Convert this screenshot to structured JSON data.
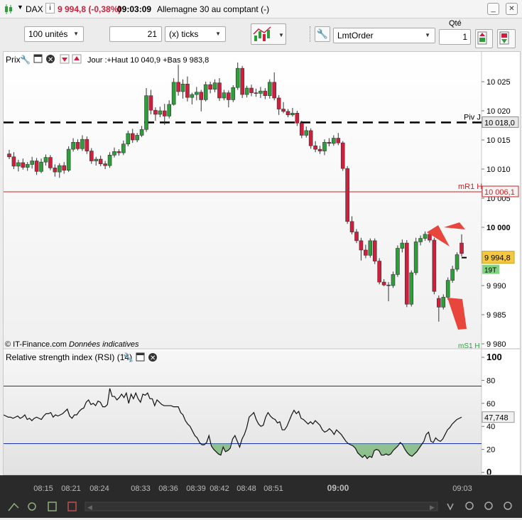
{
  "titlebar": {
    "instrument": "DAX",
    "price_change": "9 994,8 (-0,38%)",
    "time": "09:03:09",
    "description": "Allemagne 30 au comptant (-)"
  },
  "toolbar": {
    "quantity_select": "100 unités",
    "ticks_value": "21",
    "ticks_unit": "(x) ticks",
    "order_type": "LmtOrder",
    "qty_label": "Qté",
    "qty_value": "1"
  },
  "chart": {
    "price_panel_title": "Prix",
    "price_info": "Jour :+Haut 10 040,9 +Bas 9 983,8",
    "copyright": "© IT-Finance.com",
    "indicative": "Données indicatives",
    "rsi_title": "Relative strength index (RSI) (14)",
    "piv_label": "Piv J",
    "mr1_label": "mR1 H",
    "ms1_label": "mS1 H",
    "piv_value": "10 018,0",
    "mr1_value": "10 006,1",
    "last_price": "9 994,8",
    "timer": "19T",
    "rsi_value": "47,748",
    "price_ticks": [
      "10 025",
      "10 020",
      "10 015",
      "10 010",
      "10 005",
      "10 000",
      "9 990",
      "9 985",
      "9 980"
    ],
    "rsi_ticks": [
      "100",
      "80",
      "60",
      "40",
      "20",
      "0"
    ],
    "time_ticks": [
      "08:15",
      "08:21",
      "08:24",
      "08:33",
      "08:36",
      "08:39",
      "08:42",
      "08:48",
      "08:51",
      "09:00",
      "09:03"
    ]
  },
  "colors": {
    "up": "#2e9e3a",
    "down": "#d01f3c",
    "pivot": "#000000",
    "mr1": "#d02020",
    "rsi_band": "#1a2fb0",
    "arrow": "#e8453c",
    "last_price_bg": "#f5c842",
    "timer_bg": "#7ed67e"
  },
  "chart_data": {
    "type": "candlestick",
    "ylim": [
      9980,
      10028
    ],
    "rsi_ylim": [
      0,
      100
    ],
    "rsi_levels": [
      75,
      25
    ],
    "reference_lines": [
      {
        "label": "Piv J",
        "value": 10018.0
      },
      {
        "label": "mR1 H",
        "value": 10006.1
      }
    ],
    "candles": [
      {
        "o": 10012.6,
        "h": 10013.3,
        "l": 10011.7,
        "c": 10012.1
      },
      {
        "o": 10012.1,
        "h": 10012.9,
        "l": 10010.0,
        "c": 10010.5
      },
      {
        "o": 10010.5,
        "h": 10011.6,
        "l": 10009.6,
        "c": 10011.1
      },
      {
        "o": 10011.1,
        "h": 10011.8,
        "l": 10009.9,
        "c": 10010.3
      },
      {
        "o": 10010.3,
        "h": 10011.2,
        "l": 10009.7,
        "c": 10010.8
      },
      {
        "o": 10010.8,
        "h": 10012.1,
        "l": 10010.1,
        "c": 10011.4
      },
      {
        "o": 10011.4,
        "h": 10011.9,
        "l": 10009.0,
        "c": 10009.6
      },
      {
        "o": 10009.6,
        "h": 10011.8,
        "l": 10009.3,
        "c": 10011.2
      },
      {
        "o": 10011.2,
        "h": 10012.5,
        "l": 10010.6,
        "c": 10012.0
      },
      {
        "o": 10012.0,
        "h": 10012.4,
        "l": 10009.8,
        "c": 10010.2
      },
      {
        "o": 10010.2,
        "h": 10010.8,
        "l": 10008.7,
        "c": 10009.5
      },
      {
        "o": 10009.5,
        "h": 10011.0,
        "l": 10008.5,
        "c": 10010.6
      },
      {
        "o": 10010.6,
        "h": 10011.2,
        "l": 10009.2,
        "c": 10009.8
      },
      {
        "o": 10009.8,
        "h": 10013.9,
        "l": 10009.5,
        "c": 10013.4
      },
      {
        "o": 10013.4,
        "h": 10015.3,
        "l": 10013.0,
        "c": 10014.6
      },
      {
        "o": 10014.6,
        "h": 10015.1,
        "l": 10013.2,
        "c": 10013.5
      },
      {
        "o": 10013.5,
        "h": 10015.8,
        "l": 10013.1,
        "c": 10015.1
      },
      {
        "o": 10015.1,
        "h": 10015.6,
        "l": 10012.6,
        "c": 10013.1
      },
      {
        "o": 10013.1,
        "h": 10013.6,
        "l": 10010.9,
        "c": 10011.4
      },
      {
        "o": 10011.4,
        "h": 10012.1,
        "l": 10010.6,
        "c": 10011.7
      },
      {
        "o": 10011.7,
        "h": 10012.3,
        "l": 10010.5,
        "c": 10010.9
      },
      {
        "o": 10010.9,
        "h": 10011.4,
        "l": 10010.0,
        "c": 10010.6
      },
      {
        "o": 10010.6,
        "h": 10012.9,
        "l": 10010.2,
        "c": 10012.4
      },
      {
        "o": 10012.4,
        "h": 10013.7,
        "l": 10012.0,
        "c": 10013.0
      },
      {
        "o": 10013.0,
        "h": 10013.4,
        "l": 10012.3,
        "c": 10012.8
      },
      {
        "o": 10012.8,
        "h": 10014.9,
        "l": 10012.4,
        "c": 10014.3
      },
      {
        "o": 10014.3,
        "h": 10016.6,
        "l": 10013.9,
        "c": 10016.1
      },
      {
        "o": 10016.1,
        "h": 10016.9,
        "l": 10014.5,
        "c": 10015.0
      },
      {
        "o": 10015.0,
        "h": 10016.2,
        "l": 10014.6,
        "c": 10015.8
      },
      {
        "o": 10015.8,
        "h": 10017.4,
        "l": 10015.5,
        "c": 10016.8
      },
      {
        "o": 10016.8,
        "h": 10023.9,
        "l": 10016.4,
        "c": 10022.6
      },
      {
        "o": 10022.6,
        "h": 10023.6,
        "l": 10019.4,
        "c": 10020.1
      },
      {
        "o": 10020.1,
        "h": 10020.6,
        "l": 10018.3,
        "c": 10019.4
      },
      {
        "o": 10019.4,
        "h": 10020.7,
        "l": 10018.9,
        "c": 10020.0
      },
      {
        "o": 10020.0,
        "h": 10021.2,
        "l": 10017.6,
        "c": 10019.1
      },
      {
        "o": 10019.1,
        "h": 10021.8,
        "l": 10018.7,
        "c": 10021.1
      },
      {
        "o": 10021.1,
        "h": 10025.6,
        "l": 10020.9,
        "c": 10024.9
      },
      {
        "o": 10024.9,
        "h": 10027.9,
        "l": 10022.6,
        "c": 10023.3
      },
      {
        "o": 10023.3,
        "h": 10025.4,
        "l": 10022.1,
        "c": 10024.6
      },
      {
        "o": 10024.6,
        "h": 10025.9,
        "l": 10021.6,
        "c": 10022.3
      },
      {
        "o": 10022.3,
        "h": 10023.1,
        "l": 10021.1,
        "c": 10022.8
      },
      {
        "o": 10022.8,
        "h": 10024.1,
        "l": 10021.8,
        "c": 10023.2
      },
      {
        "o": 10023.2,
        "h": 10023.6,
        "l": 10019.9,
        "c": 10021.9
      },
      {
        "o": 10021.9,
        "h": 10025.0,
        "l": 10021.6,
        "c": 10024.5
      },
      {
        "o": 10024.5,
        "h": 10025.0,
        "l": 10023.0,
        "c": 10023.7
      },
      {
        "o": 10023.7,
        "h": 10025.4,
        "l": 10023.2,
        "c": 10024.8
      },
      {
        "o": 10024.8,
        "h": 10025.6,
        "l": 10021.7,
        "c": 10022.2
      },
      {
        "o": 10022.2,
        "h": 10023.6,
        "l": 10021.8,
        "c": 10023.1
      },
      {
        "o": 10023.1,
        "h": 10023.5,
        "l": 10020.6,
        "c": 10021.9
      },
      {
        "o": 10021.9,
        "h": 10024.4,
        "l": 10021.5,
        "c": 10024.0
      },
      {
        "o": 10024.0,
        "h": 10028.3,
        "l": 10023.6,
        "c": 10027.3
      },
      {
        "o": 10027.3,
        "h": 10027.7,
        "l": 10022.2,
        "c": 10022.8
      },
      {
        "o": 10022.8,
        "h": 10024.3,
        "l": 10022.3,
        "c": 10023.9
      },
      {
        "o": 10023.9,
        "h": 10024.5,
        "l": 10022.5,
        "c": 10023.1
      },
      {
        "o": 10023.1,
        "h": 10023.8,
        "l": 10022.4,
        "c": 10023.0
      },
      {
        "o": 10023.0,
        "h": 10024.1,
        "l": 10022.2,
        "c": 10023.4
      },
      {
        "o": 10023.4,
        "h": 10023.9,
        "l": 10022.0,
        "c": 10022.6
      },
      {
        "o": 10022.6,
        "h": 10025.4,
        "l": 10022.1,
        "c": 10024.9
      },
      {
        "o": 10024.9,
        "h": 10026.6,
        "l": 10021.8,
        "c": 10022.2
      },
      {
        "o": 10022.2,
        "h": 10022.7,
        "l": 10019.3,
        "c": 10020.3
      },
      {
        "o": 10020.3,
        "h": 10021.5,
        "l": 10019.6,
        "c": 10019.9
      },
      {
        "o": 10019.9,
        "h": 10020.3,
        "l": 10018.9,
        "c": 10019.3
      },
      {
        "o": 10019.3,
        "h": 10020.5,
        "l": 10019.0,
        "c": 10019.6
      },
      {
        "o": 10019.6,
        "h": 10020.0,
        "l": 10017.4,
        "c": 10017.9
      },
      {
        "o": 10017.9,
        "h": 10018.3,
        "l": 10015.3,
        "c": 10015.8
      },
      {
        "o": 10015.8,
        "h": 10017.3,
        "l": 10015.4,
        "c": 10016.6
      },
      {
        "o": 10016.6,
        "h": 10017.0,
        "l": 10013.5,
        "c": 10014.0
      },
      {
        "o": 10014.0,
        "h": 10014.8,
        "l": 10012.9,
        "c": 10013.4
      },
      {
        "o": 10013.4,
        "h": 10014.0,
        "l": 10012.6,
        "c": 10013.1
      },
      {
        "o": 10013.1,
        "h": 10015.1,
        "l": 10012.4,
        "c": 10014.6
      },
      {
        "o": 10014.6,
        "h": 10015.3,
        "l": 10013.9,
        "c": 10014.4
      },
      {
        "o": 10014.4,
        "h": 10015.8,
        "l": 10014.0,
        "c": 10015.3
      },
      {
        "o": 10015.3,
        "h": 10016.2,
        "l": 10014.1,
        "c": 10014.5
      },
      {
        "o": 10014.5,
        "h": 10014.8,
        "l": 10009.7,
        "c": 10010.1
      },
      {
        "o": 10010.1,
        "h": 10010.5,
        "l": 10000.6,
        "c": 10001.0
      },
      {
        "o": 10001.0,
        "h": 10001.9,
        "l": 9998.8,
        "c": 9999.2
      },
      {
        "o": 9999.2,
        "h": 9999.7,
        "l": 9997.3,
        "c": 9997.7
      },
      {
        "o": 9997.7,
        "h": 9998.2,
        "l": 9994.3,
        "c": 9996.1
      },
      {
        "o": 9996.1,
        "h": 9997.0,
        "l": 9994.7,
        "c": 9995.2
      },
      {
        "o": 9995.2,
        "h": 9998.1,
        "l": 9994.8,
        "c": 9997.7
      },
      {
        "o": 9997.7,
        "h": 9998.1,
        "l": 9993.7,
        "c": 9994.2
      },
      {
        "o": 9994.2,
        "h": 9994.7,
        "l": 9990.2,
        "c": 9990.6
      },
      {
        "o": 9990.6,
        "h": 9991.1,
        "l": 9989.9,
        "c": 9990.1
      },
      {
        "o": 9990.1,
        "h": 9990.6,
        "l": 9987.3,
        "c": 9990.0
      },
      {
        "o": 9990.0,
        "h": 9992.4,
        "l": 9989.6,
        "c": 9991.9
      },
      {
        "o": 9991.9,
        "h": 9996.9,
        "l": 9991.5,
        "c": 9996.4
      },
      {
        "o": 9996.4,
        "h": 9997.9,
        "l": 9995.7,
        "c": 9997.3
      },
      {
        "o": 9997.3,
        "h": 9997.8,
        "l": 9986.3,
        "c": 9986.8
      },
      {
        "o": 9986.8,
        "h": 9992.6,
        "l": 9986.4,
        "c": 9992.2
      },
      {
        "o": 9992.2,
        "h": 9998.2,
        "l": 9991.8,
        "c": 9997.5
      },
      {
        "o": 9997.5,
        "h": 9998.6,
        "l": 9996.9,
        "c": 9998.1
      },
      {
        "o": 9998.1,
        "h": 9999.3,
        "l": 9997.7,
        "c": 9998.8
      },
      {
        "o": 9998.8,
        "h": 9999.2,
        "l": 9997.4,
        "c": 9997.8
      },
      {
        "o": 9997.8,
        "h": 9998.2,
        "l": 9988.5,
        "c": 9989.0
      },
      {
        "o": 9987.8,
        "h": 9988.3,
        "l": 9983.8,
        "c": 9986.3
      },
      {
        "o": 9986.3,
        "h": 9988.5,
        "l": 9985.9,
        "c": 9988.0
      },
      {
        "o": 9988.0,
        "h": 9991.4,
        "l": 9987.6,
        "c": 9990.9
      },
      {
        "o": 9990.9,
        "h": 9993.4,
        "l": 9990.5,
        "c": 9992.8
      },
      {
        "o": 9992.8,
        "h": 9995.7,
        "l": 9992.4,
        "c": 9995.3
      },
      {
        "o": 9997.3,
        "h": 9998.8,
        "l": 9995.0,
        "c": 9995.5
      }
    ],
    "rsi": [
      50,
      49,
      48,
      48,
      47,
      48,
      49,
      47,
      48,
      50,
      46,
      47,
      45,
      47,
      48,
      47,
      46,
      49,
      51,
      51,
      52,
      48,
      50,
      49,
      50,
      51,
      53,
      55,
      49,
      47,
      50,
      50,
      53,
      55,
      56,
      61,
      63,
      59,
      60,
      58,
      62,
      61,
      57,
      57,
      59,
      73,
      66,
      66,
      63,
      65,
      68,
      65,
      69,
      60,
      68,
      64,
      69,
      64,
      61,
      68,
      67,
      69,
      64,
      64,
      58,
      63,
      61,
      59,
      58,
      58,
      58,
      58,
      57,
      57,
      57,
      52,
      50,
      45,
      42,
      40,
      36,
      32,
      30,
      26,
      24,
      24,
      26,
      32,
      23,
      20,
      18,
      16,
      15,
      22,
      18,
      19,
      21,
      29,
      32,
      27,
      22,
      29,
      33,
      39,
      48,
      50,
      52,
      46,
      42,
      40,
      41,
      48,
      52,
      49,
      47,
      46,
      43,
      44,
      37,
      37,
      40,
      45,
      50,
      54,
      51,
      53,
      47,
      46,
      44,
      42,
      44,
      42,
      45,
      43,
      41,
      37,
      35,
      36,
      38,
      36,
      33,
      37,
      35,
      33,
      30,
      27,
      25,
      24,
      23,
      21,
      17,
      15,
      13,
      15,
      12,
      14,
      13,
      19,
      20,
      19,
      15,
      15,
      16,
      15,
      16,
      19,
      21,
      23,
      26,
      24,
      20,
      17,
      15,
      14,
      16,
      18,
      21,
      24,
      27,
      33,
      35,
      27,
      26,
      30,
      28,
      27,
      29,
      33,
      37,
      39,
      42,
      44,
      46,
      47,
      48
    ]
  }
}
